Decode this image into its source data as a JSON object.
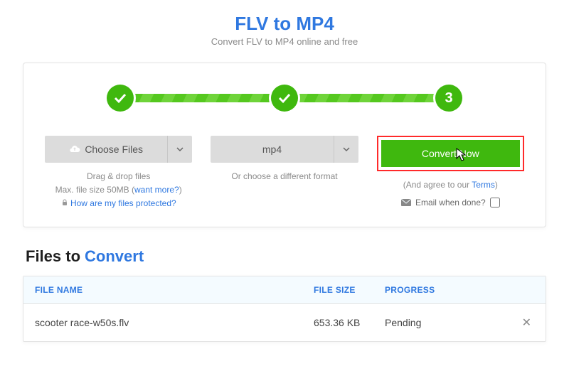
{
  "header": {
    "title": "FLV to MP4",
    "subtitle": "Convert FLV to MP4 online and free"
  },
  "steps": {
    "step1": "done",
    "step2": "done",
    "step3_label": "3"
  },
  "col_files": {
    "button_label": "Choose Files",
    "hint_line1": "Drag & drop files",
    "hint_line2_prefix": "Max. file size 50MB (",
    "hint_line2_link": "want more?",
    "hint_line2_suffix": ")",
    "hint_line3": "How are my files protected?"
  },
  "col_format": {
    "selected_format": "mp4",
    "hint": "Or choose a different format"
  },
  "col_convert": {
    "button_label": "Convert Now",
    "agree_prefix": "(And agree to our ",
    "agree_link": "Terms",
    "agree_suffix": ")",
    "email_label": "Email when done?"
  },
  "files_section": {
    "title_a": "Files to",
    "title_b": "Convert",
    "col_name": "FILE NAME",
    "col_size": "FILE SIZE",
    "col_prog": "PROGRESS",
    "rows": [
      {
        "name": "scooter race-w50s.flv",
        "size": "653.36 KB",
        "progress": "Pending"
      }
    ]
  }
}
